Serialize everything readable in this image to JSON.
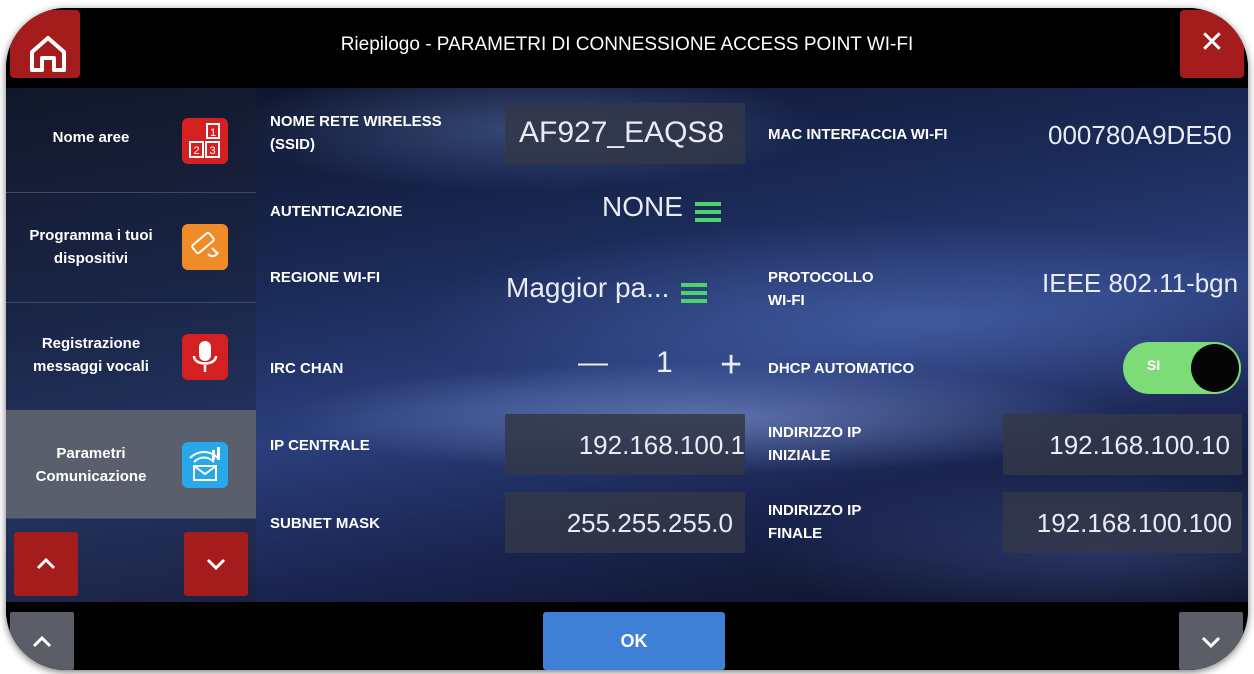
{
  "header": {
    "title": "Riepilogo - PARAMETRI DI CONNESSIONE ACCESS POINT WI-FI",
    "home_icon": "home-icon",
    "close_label": "✕"
  },
  "sidebar": {
    "items": [
      {
        "label": "Nome aree",
        "icon": "numbered-areas-icon"
      },
      {
        "label": "Programma i tuoi dispositivi",
        "icon": "device-programming-icon"
      },
      {
        "label": "Registrazione messaggi vocali",
        "icon": "microphone-icon"
      },
      {
        "label": "Parametri Comunicazione",
        "icon": "wifi-communication-icon"
      }
    ],
    "active_index": 3
  },
  "fields": {
    "ssid": {
      "label": "NOME RETE WIRELESS (SSID)",
      "value": "AF927_EAQS8"
    },
    "mac": {
      "label": "MAC INTERFACCIA WI-FI",
      "value": "000780A9DE50"
    },
    "auth": {
      "label": "AUTENTICAZIONE",
      "value": "NONE"
    },
    "region": {
      "label": "REGIONE WI-FI",
      "value": "Maggior pa..."
    },
    "protocol": {
      "label": "PROTOCOLLO WI-FI",
      "value": "IEEE 802.11-bgn"
    },
    "irc": {
      "label": "IRC CHAN",
      "value": "1",
      "minus": "—",
      "plus": "+"
    },
    "dhcp": {
      "label": "DHCP AUTOMATICO",
      "value": "SI",
      "on": true
    },
    "ip_central": {
      "label": "IP CENTRALE",
      "value": "192.168.100.1"
    },
    "ip_start": {
      "label": "INDIRIZZO IP INIZIALE",
      "value": "192.168.100.10"
    },
    "subnet": {
      "label": "SUBNET MASK",
      "value": "255.255.255.0"
    },
    "ip_end": {
      "label": "INDIRIZZO IP FINALE",
      "value": "192.168.100.100"
    }
  },
  "footer": {
    "ok_label": "OK"
  },
  "colors": {
    "accent_red": "#a51c1c",
    "ok_blue": "#3d80d6",
    "toggle_green": "#7ddc78",
    "menu_green": "#4cd36a"
  }
}
